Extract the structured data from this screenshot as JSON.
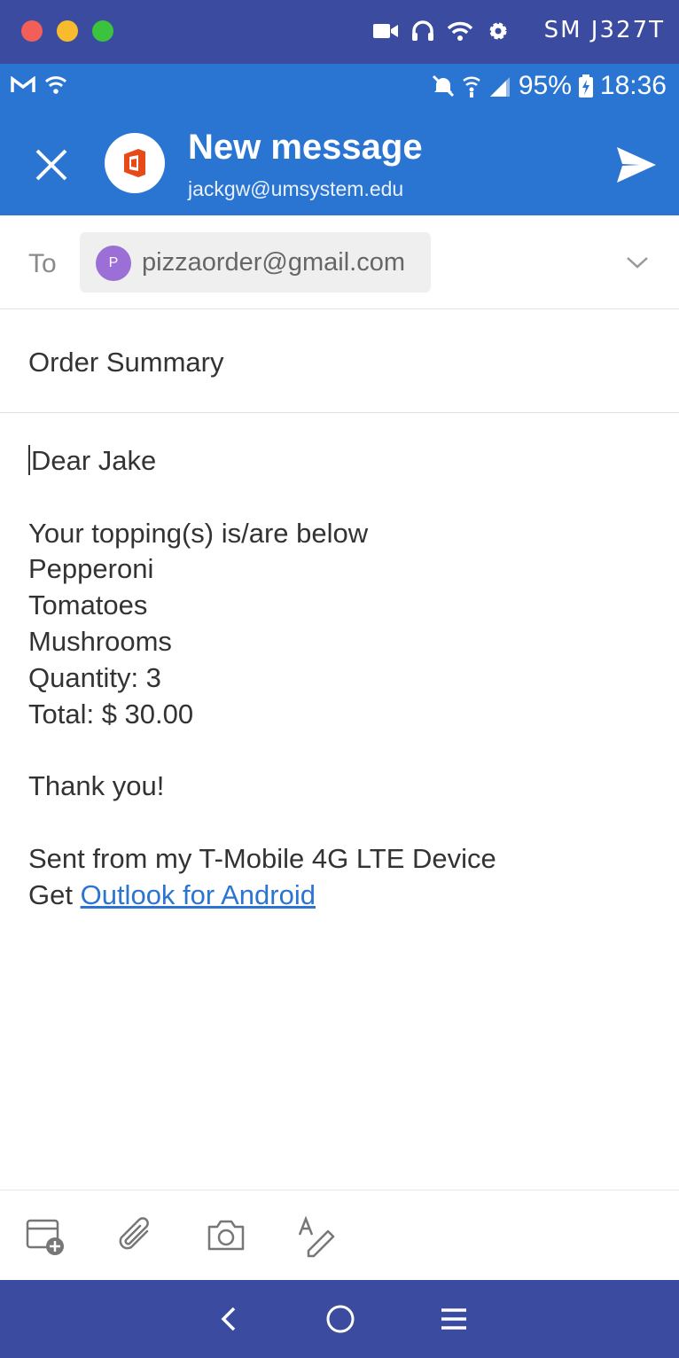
{
  "emulator": {
    "device_name": "SM J327T",
    "icons": [
      "video-camera-icon",
      "headphones-icon",
      "wifi-icon",
      "settings-icon"
    ]
  },
  "status_bar": {
    "left_icons": [
      "gmail-icon",
      "wifi-icon"
    ],
    "right_icons": [
      "mute-icon",
      "wifi-signal-icon",
      "cell-signal-icon",
      "battery-icon"
    ],
    "battery": "95%",
    "time": "18:36"
  },
  "header": {
    "title": "New message",
    "account": "jackgw@umsystem.edu",
    "app_logo": "office-logo-icon"
  },
  "compose": {
    "to_label": "To",
    "recipient_initial": "P",
    "recipient": "pizzaorder@gmail.com",
    "subject": "Order Summary",
    "body": {
      "greeting": "Dear Jake",
      "intro": "Your topping(s) is/are below",
      "toppings": [
        "Pepperoni",
        "Tomatoes",
        "Mushrooms"
      ],
      "quantity": "Quantity: 3",
      "total": "Total: $ 30.00",
      "thanks": "Thank you!",
      "signature": "Sent from my T-Mobile 4G LTE Device",
      "get_prefix": "Get ",
      "link_text": "Outlook for Android"
    }
  },
  "toolbar": {
    "items": [
      "calendar-add-icon",
      "attachment-icon",
      "camera-icon",
      "format-text-icon"
    ]
  },
  "nav": {
    "items": [
      "back-icon",
      "home-icon",
      "menu-icon"
    ]
  },
  "colors": {
    "header_blue": "#2a74d2",
    "chrome_blue": "#3b4ba0",
    "chip_avatar": "#9b6fd6"
  }
}
